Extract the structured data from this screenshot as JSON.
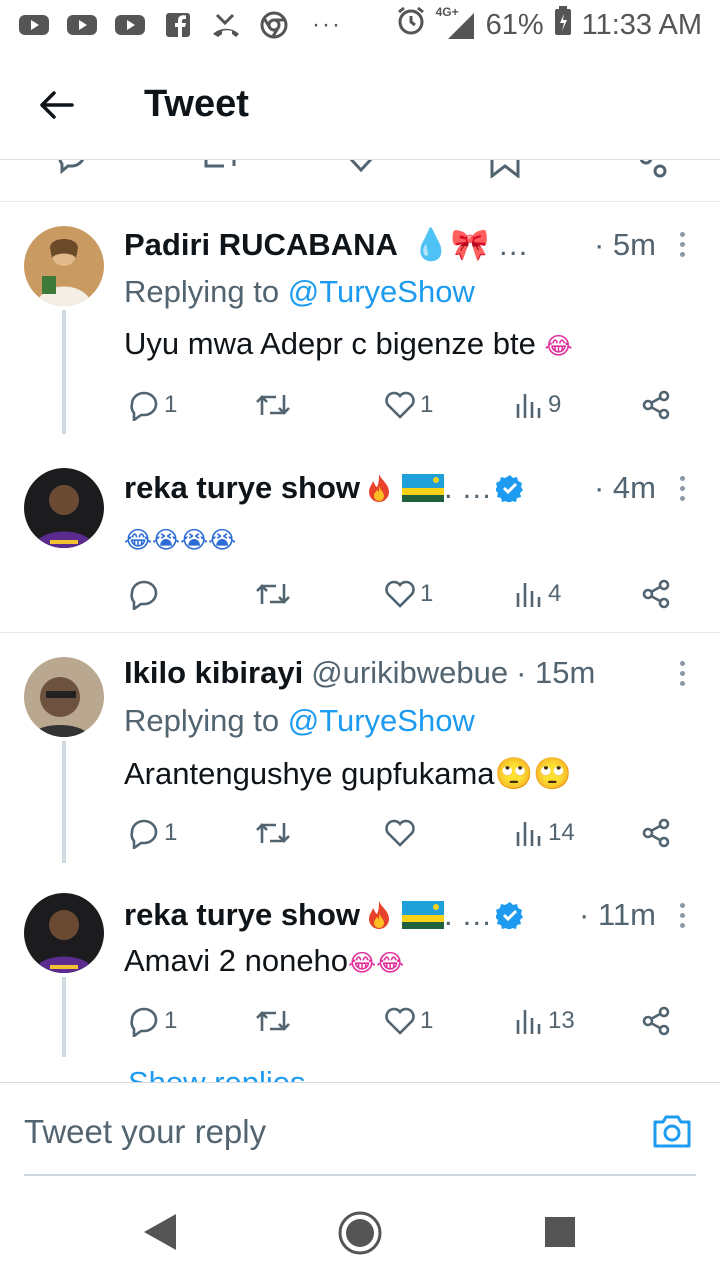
{
  "status_bar": {
    "battery": "61%",
    "time": "11:33 AM",
    "network": "4G+",
    "overflow": "···",
    "icons": [
      "youtube-icon",
      "youtube-icon",
      "youtube-icon",
      "facebook-icon",
      "missed-call-icon",
      "chrome-icon",
      "alarm-icon",
      "signal-icon",
      "battery-icon"
    ]
  },
  "header": {
    "title": "Tweet"
  },
  "composer": {
    "placeholder": "Tweet your reply"
  },
  "accent_color": "#1d9bf0",
  "tweets": [
    {
      "name": "Padiri RUCABANA",
      "name_decor": "💧🎀 …",
      "time": "· 5m",
      "reply_label": "Replying to ",
      "reply_mention": "@TuryeShow",
      "text": "Uyu mwa Adepr c bigenze bte",
      "text_emoji": "😂",
      "replies": "1",
      "retweets": "",
      "likes": "1",
      "views": "9"
    },
    {
      "name": "reka turye show",
      "name_decor": ". …",
      "time": "· 4m",
      "text": "",
      "text_emoji": "😂😭😭😭",
      "replies": "",
      "retweets": "",
      "likes": "1",
      "views": "4"
    },
    {
      "name": "Ikilo kibirayi",
      "handle": "@urikibwebue",
      "time": "· 15m",
      "reply_label": "Replying to ",
      "reply_mention": "@TuryeShow",
      "text": "Arantengushye gupfukama",
      "text_emoji": "🙄🙄",
      "replies": "1",
      "retweets": "",
      "likes": "",
      "views": "14"
    },
    {
      "name": "reka turye show",
      "name_decor": ". …",
      "time": "· 11m",
      "text": "Amavi 2 noneho",
      "text_emoji": "😂😂",
      "replies": "1",
      "retweets": "",
      "likes": "1",
      "views": "13"
    }
  ],
  "show_replies": "Show replies"
}
